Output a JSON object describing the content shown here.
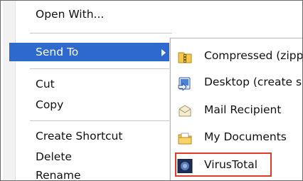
{
  "context_menu": {
    "items": [
      {
        "label": "Open With..."
      },
      {
        "label": "Send To"
      },
      {
        "label": "Cut"
      },
      {
        "label": "Copy"
      },
      {
        "label": "Create Shortcut"
      },
      {
        "label": "Delete"
      },
      {
        "label": "Rename"
      }
    ],
    "selected_color": "#2e6ace"
  },
  "send_to_submenu": {
    "items": [
      {
        "label": "Compressed (zipp",
        "icon": "zip-folder-icon"
      },
      {
        "label": "Desktop (create s",
        "icon": "desktop-icon"
      },
      {
        "label": "Mail Recipient",
        "icon": "mail-envelope-icon"
      },
      {
        "label": "My Documents",
        "icon": "documents-folder-icon"
      },
      {
        "label": "VirusTotal",
        "icon": "virustotal-icon"
      }
    ],
    "highlight_color": "#e03a2a"
  }
}
